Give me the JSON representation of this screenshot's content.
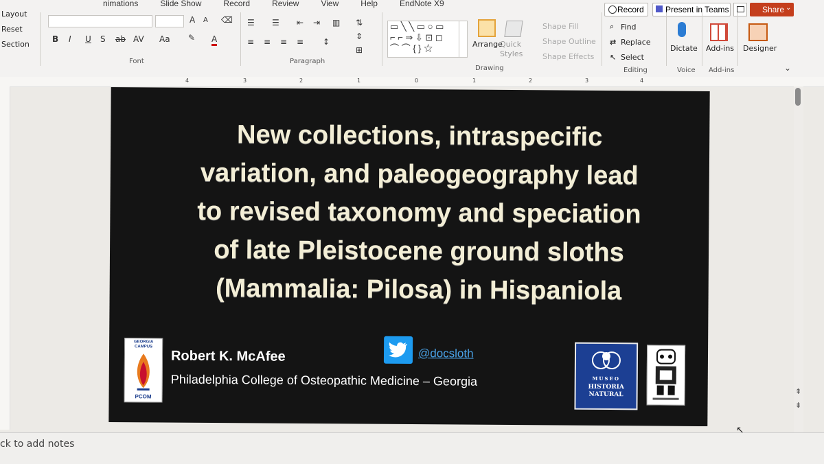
{
  "ribbon": {
    "tabs": [
      "nimations",
      "Slide Show",
      "Record",
      "Review",
      "View",
      "Help",
      "EndNote X9"
    ],
    "left_buttons": {
      "layout": "Layout",
      "reset": "Reset",
      "section": "Section"
    },
    "groups": {
      "font": "Font",
      "paragraph": "Paragraph",
      "drawing": "Drawing",
      "editing": "Editing",
      "voice": "Voice",
      "addins": "Add-ins"
    },
    "drawing": {
      "arrange": "Arrange",
      "quick_styles": "Quick Styles",
      "shape_fill": "Shape Fill",
      "shape_outline": "Shape Outline",
      "shape_effects": "Shape Effects"
    },
    "editing": {
      "find": "Find",
      "replace": "Replace",
      "select": "Select"
    },
    "voice": {
      "dictate": "Dictate"
    },
    "addins": {
      "addins": "Add-ins",
      "designer": "Designer"
    },
    "font_format": {
      "bold": "B",
      "italic": "I",
      "underline": "U",
      "shadow": "S",
      "strike": "ab",
      "spacing": "AV",
      "case": "Aa",
      "grow": "A",
      "shrink": "A"
    },
    "top_right": {
      "record": "Record",
      "present_teams": "Present in Teams",
      "share": "Share"
    }
  },
  "ruler": {
    "ticks": [
      "4",
      "3",
      "2",
      "1",
      "0",
      "1",
      "2",
      "3",
      "4"
    ]
  },
  "slide": {
    "title_lines": [
      "New collections, intraspecific",
      "variation, and paleogeography lead",
      "to revised taxonomy and speciation",
      "of late Pleistocene ground sloths",
      "(Mammalia: Pilosa) in Hispaniola"
    ],
    "author": "Robert K. McAfee",
    "affiliation": "Philadelphia College of Osteopathic Medicine – Georgia",
    "twitter_handle": "@docsloth",
    "pcom_logo": {
      "top": "GEORGIA CAMPUS",
      "bottom": "PCOM"
    },
    "museo_logo": {
      "line1": "MUSEO",
      "line2": "HISTORIA NATURAL"
    }
  },
  "notes": {
    "placeholder": "ck to add notes"
  },
  "colors": {
    "slide_bg": "#141414",
    "title": "#f3eed6",
    "share": "#c43e1c",
    "twitter": "#1d9bf0"
  }
}
